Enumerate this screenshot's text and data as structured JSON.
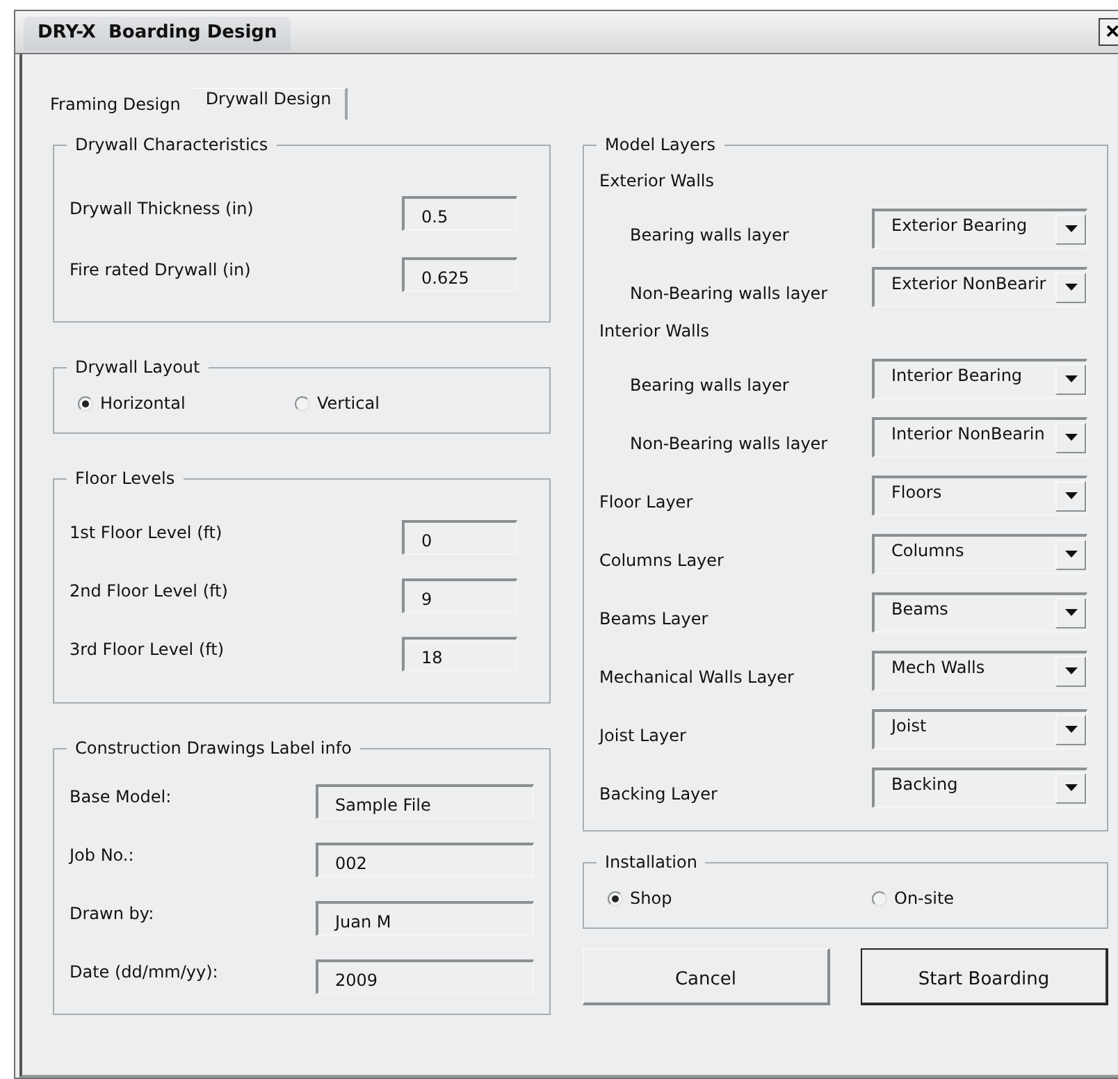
{
  "window": {
    "title": "DRY-X  Boarding Design",
    "close": "×"
  },
  "tabs": [
    {
      "label": "Framing Design",
      "selected": false
    },
    {
      "label": "Drywall Design",
      "selected": true
    }
  ],
  "drywall_characteristics": {
    "title": "Drywall Characteristics",
    "fields": [
      {
        "label": "Drywall Thickness (in)",
        "value": "0.5"
      },
      {
        "label": "Fire rated Drywall (in)",
        "value": "0.625"
      }
    ]
  },
  "drywall_layout": {
    "title": "Drywall Layout",
    "options": [
      {
        "label": "Horizontal",
        "selected": true
      },
      {
        "label": "Vertical",
        "selected": false
      }
    ]
  },
  "floor_levels": {
    "title": "Floor Levels",
    "fields": [
      {
        "label": "1st Floor Level (ft)",
        "value": "0"
      },
      {
        "label": "2nd Floor Level (ft)",
        "value": "9"
      },
      {
        "label": "3rd Floor Level (ft)",
        "value": "18"
      }
    ]
  },
  "label_info": {
    "title": "Construction Drawings Label info",
    "fields": [
      {
        "label": "Base Model:",
        "value": "Sample File"
      },
      {
        "label": "Job No.:",
        "value": "002"
      },
      {
        "label": "Drawn by:",
        "value": "Juan M"
      },
      {
        "label": "Date (dd/mm/yy):",
        "value": "2009"
      }
    ]
  },
  "model_layers": {
    "title": "Model Layers",
    "rows": [
      {
        "kind": "heading",
        "label": "Exterior Walls"
      },
      {
        "kind": "sub",
        "label": "Bearing walls layer",
        "value": "Exterior Bearing"
      },
      {
        "kind": "sub",
        "label": "Non-Bearing walls layer",
        "value": "Exterior NonBearir"
      },
      {
        "kind": "heading",
        "label": "Interior Walls"
      },
      {
        "kind": "sub",
        "label": "Bearing walls layer",
        "value": "Interior Bearing"
      },
      {
        "kind": "sub",
        "label": "Non-Bearing walls layer",
        "value": "Interior NonBearin"
      },
      {
        "kind": "main",
        "label": "Floor Layer",
        "value": "Floors"
      },
      {
        "kind": "main",
        "label": "Columns Layer",
        "value": "Columns"
      },
      {
        "kind": "main",
        "label": "Beams Layer",
        "value": "Beams"
      },
      {
        "kind": "main",
        "label": "Mechanical Walls Layer",
        "value": "Mech Walls"
      },
      {
        "kind": "main",
        "label": "Joist Layer",
        "value": "Joist"
      },
      {
        "kind": "main",
        "label": "Backing Layer",
        "value": "Backing"
      }
    ]
  },
  "installation": {
    "title": "Installation",
    "options": [
      {
        "label": "Shop",
        "selected": true
      },
      {
        "label": "On-site",
        "selected": false
      }
    ]
  },
  "buttons": [
    {
      "label": "Cancel",
      "default": false
    },
    {
      "label": "Start Boarding",
      "default": true
    }
  ]
}
